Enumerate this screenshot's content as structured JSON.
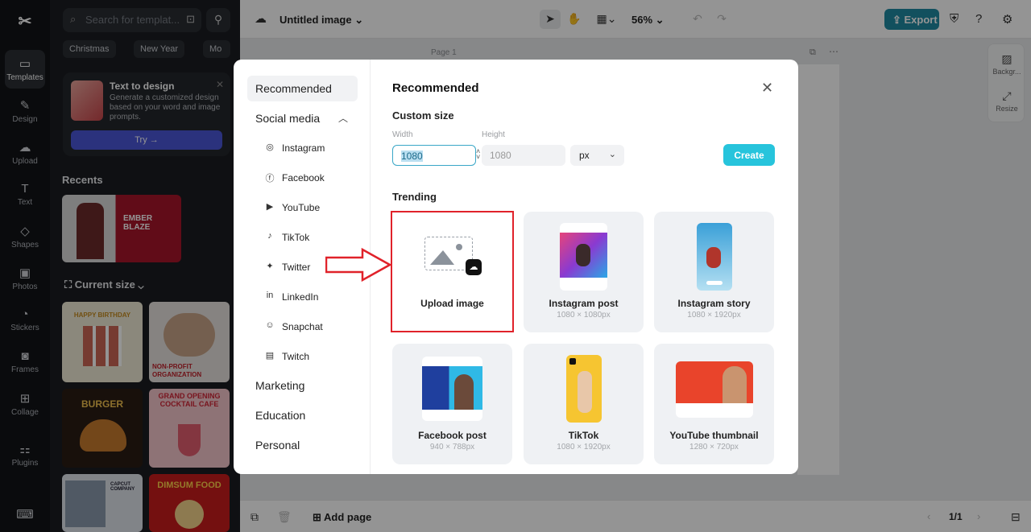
{
  "rail": {
    "items": [
      {
        "label": "Templates",
        "icon": "templates-icon"
      },
      {
        "label": "Design",
        "icon": "design-icon"
      },
      {
        "label": "Upload",
        "icon": "upload-icon"
      },
      {
        "label": "Text",
        "icon": "text-icon"
      },
      {
        "label": "Shapes",
        "icon": "shapes-icon"
      },
      {
        "label": "Photos",
        "icon": "photos-icon"
      },
      {
        "label": "Stickers",
        "icon": "stickers-icon"
      },
      {
        "label": "Frames",
        "icon": "frames-icon"
      },
      {
        "label": "Collage",
        "icon": "collage-icon"
      },
      {
        "label": "Plugins",
        "icon": "plugins-icon"
      }
    ]
  },
  "panel": {
    "search_placeholder": "Search for templat...",
    "chips": [
      "Christmas",
      "New Year",
      "Mo"
    ],
    "promo": {
      "title": "Text to design",
      "description": "Generate a customized design based on your word and image prompts.",
      "try_label": "Try →"
    },
    "recents_label": "Recents",
    "current_size_label": "Current size",
    "thumb_texts": {
      "ember": "EMBER BLAZE",
      "birthday": "HAPPY BIRTHDAY",
      "nonprofit": "NON-PROFIT ORGANIZATION",
      "burger": "BURGER",
      "cocktail": "GRAND OPENING COCKTAIL CAFE",
      "capcut": "CAPCUT COMPANY",
      "dimsum": "DIMSUM FOOD"
    }
  },
  "topbar": {
    "doc_title": "Untitled image",
    "zoom": "56%",
    "export_label": "Export"
  },
  "canvas": {
    "page_label": "Page 1",
    "side_tools": [
      "Backgr...",
      "Resize"
    ]
  },
  "bottombar": {
    "add_page_label": "Add page",
    "pager": "1/1"
  },
  "modal": {
    "nav": {
      "recommended": "Recommended",
      "social_media": "Social media",
      "social_items": [
        {
          "label": "Instagram",
          "icon": "instagram-icon"
        },
        {
          "label": "Facebook",
          "icon": "facebook-icon"
        },
        {
          "label": "YouTube",
          "icon": "youtube-icon"
        },
        {
          "label": "TikTok",
          "icon": "tiktok-icon"
        },
        {
          "label": "Twitter",
          "icon": "twitter-icon"
        },
        {
          "label": "LinkedIn",
          "icon": "linkedin-icon"
        },
        {
          "label": "Snapchat",
          "icon": "snapchat-icon"
        },
        {
          "label": "Twitch",
          "icon": "twitch-icon"
        }
      ],
      "marketing": "Marketing",
      "education": "Education",
      "personal": "Personal"
    },
    "title": "Recommended",
    "custom_size_label": "Custom size",
    "width_label": "Width",
    "height_label": "Height",
    "width_value": "1080",
    "height_placeholder": "1080",
    "unit": "px",
    "create_label": "Create",
    "trending_label": "Trending",
    "cards": [
      {
        "name": "Upload image",
        "size": ""
      },
      {
        "name": "Instagram post",
        "size": "1080 × 1080px"
      },
      {
        "name": "Instagram story",
        "size": "1080 × 1920px"
      },
      {
        "name": "Facebook post",
        "size": "940 × 788px"
      },
      {
        "name": "TikTok",
        "size": "1080 × 1920px"
      },
      {
        "name": "YouTube thumbnail",
        "size": "1280 × 720px"
      }
    ]
  },
  "colors": {
    "accent": "#27c4dc",
    "export": "#1f8ba3",
    "annotation": "#e0222a"
  }
}
